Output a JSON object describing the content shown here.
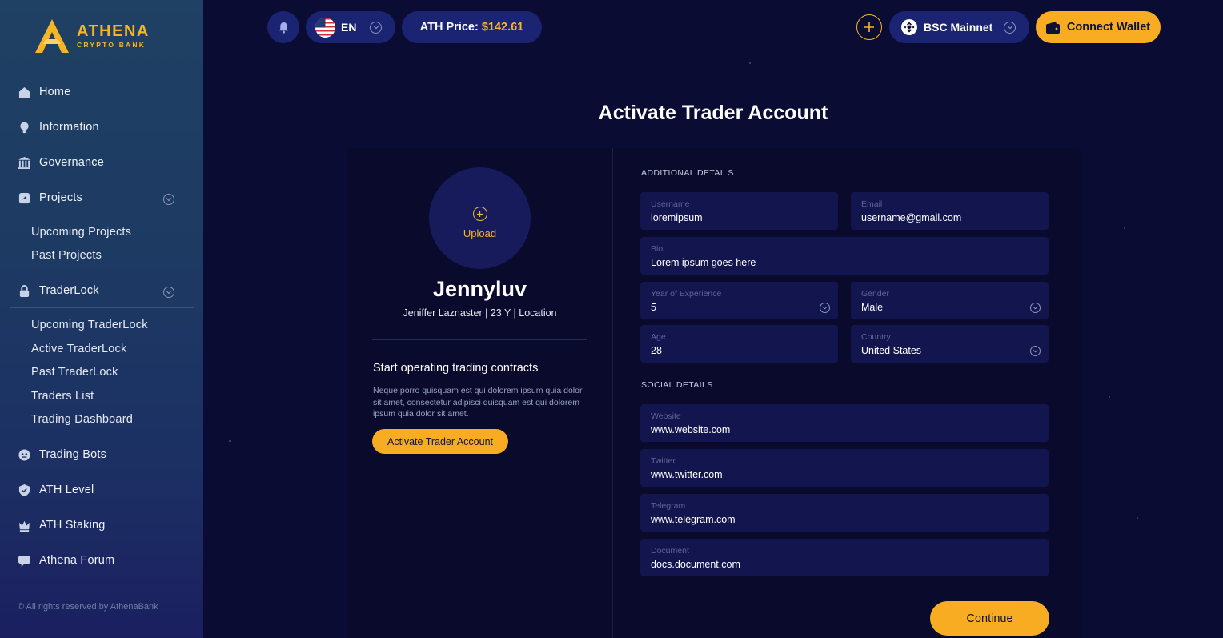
{
  "brand": {
    "name": "ATHENA",
    "tagline": "CRYPTO BANK",
    "accent": "#f5b525"
  },
  "sidebar": {
    "items": [
      {
        "label": "Home",
        "icon": "home-icon"
      },
      {
        "label": "Information",
        "icon": "bulb-icon"
      },
      {
        "label": "Governance",
        "icon": "bank-icon"
      },
      {
        "label": "Projects",
        "icon": "folder-icon",
        "expanded": true,
        "children": [
          "Upcoming Projects",
          "Past Projects"
        ]
      },
      {
        "label": "TraderLock",
        "icon": "lock-icon",
        "expanded": true,
        "children": [
          "Upcoming TraderLock",
          "Active TraderLock",
          "Past TraderLock",
          "Traders List",
          "Trading Dashboard"
        ]
      },
      {
        "label": "Trading Bots",
        "icon": "bot-icon"
      },
      {
        "label": "ATH Level",
        "icon": "shield-icon"
      },
      {
        "label": "ATH Staking",
        "icon": "crown-icon"
      },
      {
        "label": "Athena Forum",
        "icon": "chat-icon"
      }
    ],
    "copyright": "© All rights reserved by AthenaBank"
  },
  "topbar": {
    "language": "EN",
    "price_label": "ATH Price:",
    "price_value": "$142.61",
    "network": "BSC Mainnet",
    "connect_label": "Connect Wallet"
  },
  "page": {
    "title": "Activate Trader Account",
    "upload_label": "Upload",
    "display_name": "Jennyluv",
    "meta": "Jeniffer Laznaster | 23 Y | Location",
    "start_title": "Start operating trading contracts",
    "start_desc": "Neque porro quisquam est qui dolorem ipsum quia dolor sit amet, consectetur adipisci quisquam est qui dolorem ipsum quia dolor sit amet.",
    "activate_label": "Activate Trader Account",
    "additional_title": "ADDITIONAL DETAILS",
    "social_title": "SOCIAL DETAILS",
    "continue_label": "Continue"
  },
  "fields": {
    "username": {
      "label": "Username",
      "value": "loremipsum"
    },
    "email": {
      "label": "Email",
      "value": "username@gmail.com"
    },
    "bio": {
      "label": "Bio",
      "value": "Lorem ipsum goes here"
    },
    "experience": {
      "label": "Year of Experience",
      "value": "5"
    },
    "gender": {
      "label": "Gender",
      "value": "Male"
    },
    "age": {
      "label": "Age",
      "value": "28"
    },
    "country": {
      "label": "Country",
      "value": "United States"
    },
    "website": {
      "label": "Website",
      "value": "www.website.com"
    },
    "twitter": {
      "label": "Twitter",
      "value": "www.twitter.com"
    },
    "telegram": {
      "label": "Telegram",
      "value": "www.telegram.com"
    },
    "document": {
      "label": "Document",
      "value": "docs.document.com"
    }
  }
}
